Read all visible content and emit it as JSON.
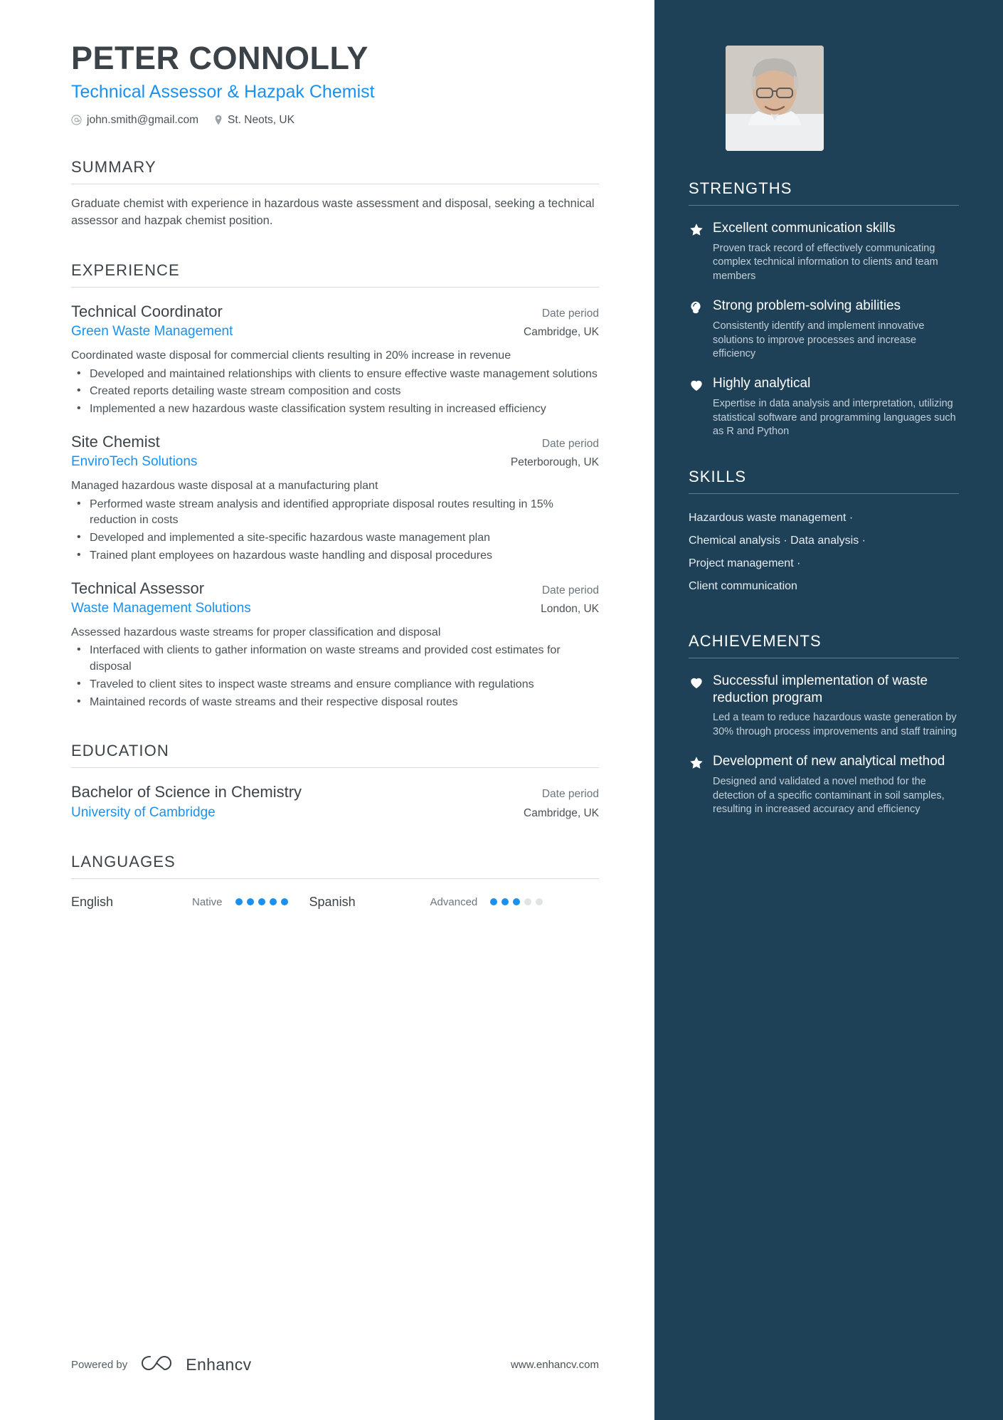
{
  "header": {
    "name": "PETER CONNOLLY",
    "role": "Technical Assessor & Hazpak Chemist",
    "email": "john.smith@gmail.com",
    "location": "St. Neots, UK",
    "email_icon": "at-icon",
    "location_icon": "map-pin-icon",
    "photo_alt": "profile-photo"
  },
  "summary": {
    "title": "SUMMARY",
    "text": "Graduate chemist with experience in hazardous waste assessment and disposal, seeking a technical assessor and hazpak chemist position."
  },
  "experience": {
    "title": "EXPERIENCE",
    "entries": [
      {
        "title": "Technical Coordinator",
        "date": "Date period",
        "org": "Green Waste Management",
        "location": "Cambridge, UK",
        "desc": "Coordinated waste disposal for commercial clients resulting in 20% increase in revenue",
        "bullets": [
          "Developed and maintained relationships with clients to ensure effective waste management solutions",
          "Created reports detailing waste stream composition and costs",
          "Implemented a new hazardous waste classification system resulting in increased efficiency"
        ]
      },
      {
        "title": "Site Chemist",
        "date": "Date period",
        "org": "EnviroTech Solutions",
        "location": "Peterborough, UK",
        "desc": "Managed hazardous waste disposal at a manufacturing plant",
        "bullets": [
          "Performed waste stream analysis and identified appropriate disposal routes resulting in 15% reduction in costs",
          "Developed and implemented a site-specific hazardous waste management plan",
          "Trained plant employees on hazardous waste handling and disposal procedures"
        ]
      },
      {
        "title": "Technical Assessor",
        "date": "Date period",
        "org": "Waste Management Solutions",
        "location": "London, UK",
        "desc": "Assessed hazardous waste streams for proper classification and disposal",
        "bullets": [
          "Interfaced with clients to gather information on waste streams and provided cost estimates for disposal",
          "Traveled to client sites to inspect waste streams and ensure compliance with regulations",
          "Maintained records of waste streams and their respective disposal routes"
        ]
      }
    ]
  },
  "education": {
    "title": "EDUCATION",
    "entries": [
      {
        "title": "Bachelor of Science in Chemistry",
        "date": "Date period",
        "org": "University of Cambridge",
        "location": "Cambridge, UK"
      }
    ]
  },
  "languages": {
    "title": "LANGUAGES",
    "items": [
      {
        "name": "English",
        "level": "Native",
        "filled": 5,
        "total": 5
      },
      {
        "name": "Spanish",
        "level": "Advanced",
        "filled": 3,
        "total": 5
      }
    ]
  },
  "strengths": {
    "title": "STRENGTHS",
    "items": [
      {
        "icon": "star-icon",
        "name": "Excellent communication skills",
        "desc": "Proven track record of effectively communicating complex technical information to clients and team members"
      },
      {
        "icon": "lightbulb-icon",
        "name": "Strong problem-solving abilities",
        "desc": "Consistently identify and implement innovative solutions to improve processes and increase efficiency"
      },
      {
        "icon": "heart-icon",
        "name": "Highly analytical",
        "desc": "Expertise in data analysis and interpretation, utilizing statistical software and programming languages such as R and Python"
      }
    ]
  },
  "skills": {
    "title": "SKILLS",
    "lines": [
      "Hazardous waste management ·",
      "Chemical analysis · Data analysis ·",
      "Project management ·",
      "Client communication"
    ]
  },
  "achievements": {
    "title": "ACHIEVEMENTS",
    "items": [
      {
        "icon": "heart-icon",
        "name": "Successful implementation of waste reduction program",
        "desc": "Led a team to reduce hazardous waste generation by 30% through process improvements and staff training"
      },
      {
        "icon": "star-icon",
        "name": "Development of new analytical method",
        "desc": "Designed and validated a novel method for the detection of a specific contaminant in soil samples, resulting in increased accuracy and efficiency"
      }
    ]
  },
  "footer": {
    "powered_by": "Powered by",
    "brand": "Enhancv",
    "brand_icon": "enhancv-logo-icon",
    "website": "www.enhancv.com"
  },
  "colors": {
    "accent_blue": "#1a91f0",
    "sidebar_bg": "#1f4158",
    "heading": "#3b4348",
    "body": "#4a5257"
  }
}
